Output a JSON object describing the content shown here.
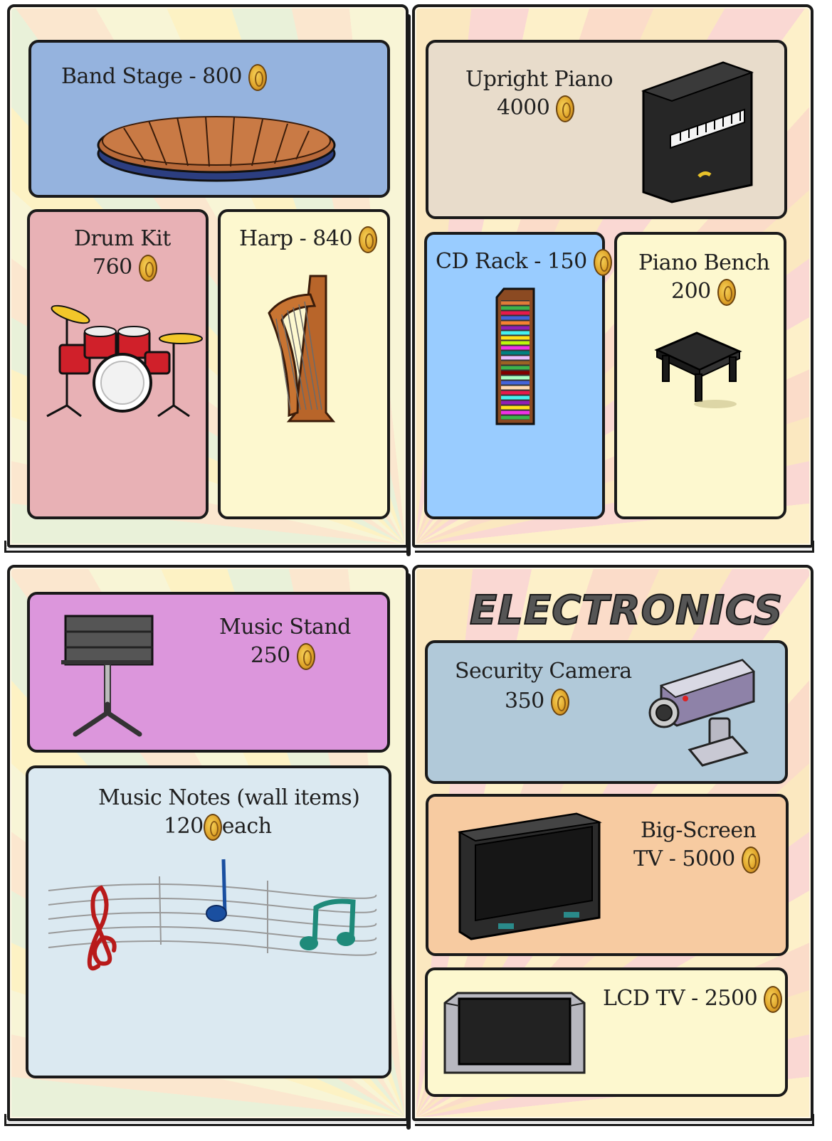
{
  "catalog": {
    "spread1": {
      "left_page": {
        "items": [
          {
            "id": "band-stage",
            "label": "Band Stage - 800"
          },
          {
            "id": "drum-kit",
            "line1": "Drum Kit",
            "line2": "760"
          },
          {
            "id": "harp",
            "label": "Harp - 840"
          }
        ]
      },
      "right_page": {
        "items": [
          {
            "id": "upright-piano",
            "line1": "Upright Piano",
            "line2": "4000"
          },
          {
            "id": "cd-rack",
            "label": "CD Rack - 150"
          },
          {
            "id": "piano-bench",
            "line1": "Piano Bench",
            "line2": "200"
          }
        ]
      }
    },
    "spread2": {
      "left_page": {
        "items": [
          {
            "id": "music-stand",
            "line1": "Music Stand",
            "line2": "250"
          },
          {
            "id": "music-notes",
            "line1": "Music Notes (wall items)",
            "line2a": "120",
            "line2b": "each"
          }
        ]
      },
      "right_page": {
        "heading": "ELECTRONICS",
        "items": [
          {
            "id": "security-camera",
            "line1": "Security Camera",
            "line2": "350"
          },
          {
            "id": "big-screen-tv",
            "line1": "Big-Screen",
            "line2": "TV - 5000"
          },
          {
            "id": "lcd-tv",
            "label": "LCD TV - 2500"
          }
        ]
      }
    }
  },
  "icons": {
    "coin": "coin-icon",
    "band_stage": "band-stage-icon",
    "drum_kit": "drum-kit-icon",
    "harp": "harp-icon",
    "upright_piano": "upright-piano-icon",
    "cd_rack": "cd-rack-icon",
    "piano_bench": "piano-bench-icon",
    "music_stand": "music-stand-icon",
    "music_notes": "music-notes-icon",
    "security_camera": "security-camera-icon",
    "big_screen_tv": "big-screen-tv-icon",
    "lcd_tv": "lcd-tv-icon"
  },
  "colors": {
    "band_stage_bg": "#95b3de",
    "drum_kit_bg": "#e8b1b5",
    "harp_bg": "#fdf8cf",
    "upright_piano_bg": "#e8dccb",
    "cd_rack_bg": "#99ccff",
    "piano_bench_bg": "#fdf8cf",
    "music_stand_bg": "#dc96dc",
    "music_notes_bg": "#dbe9f1",
    "security_camera_bg": "#b1c9d9",
    "big_screen_tv_bg": "#f7cba1",
    "lcd_tv_bg": "#fdf8cf"
  }
}
